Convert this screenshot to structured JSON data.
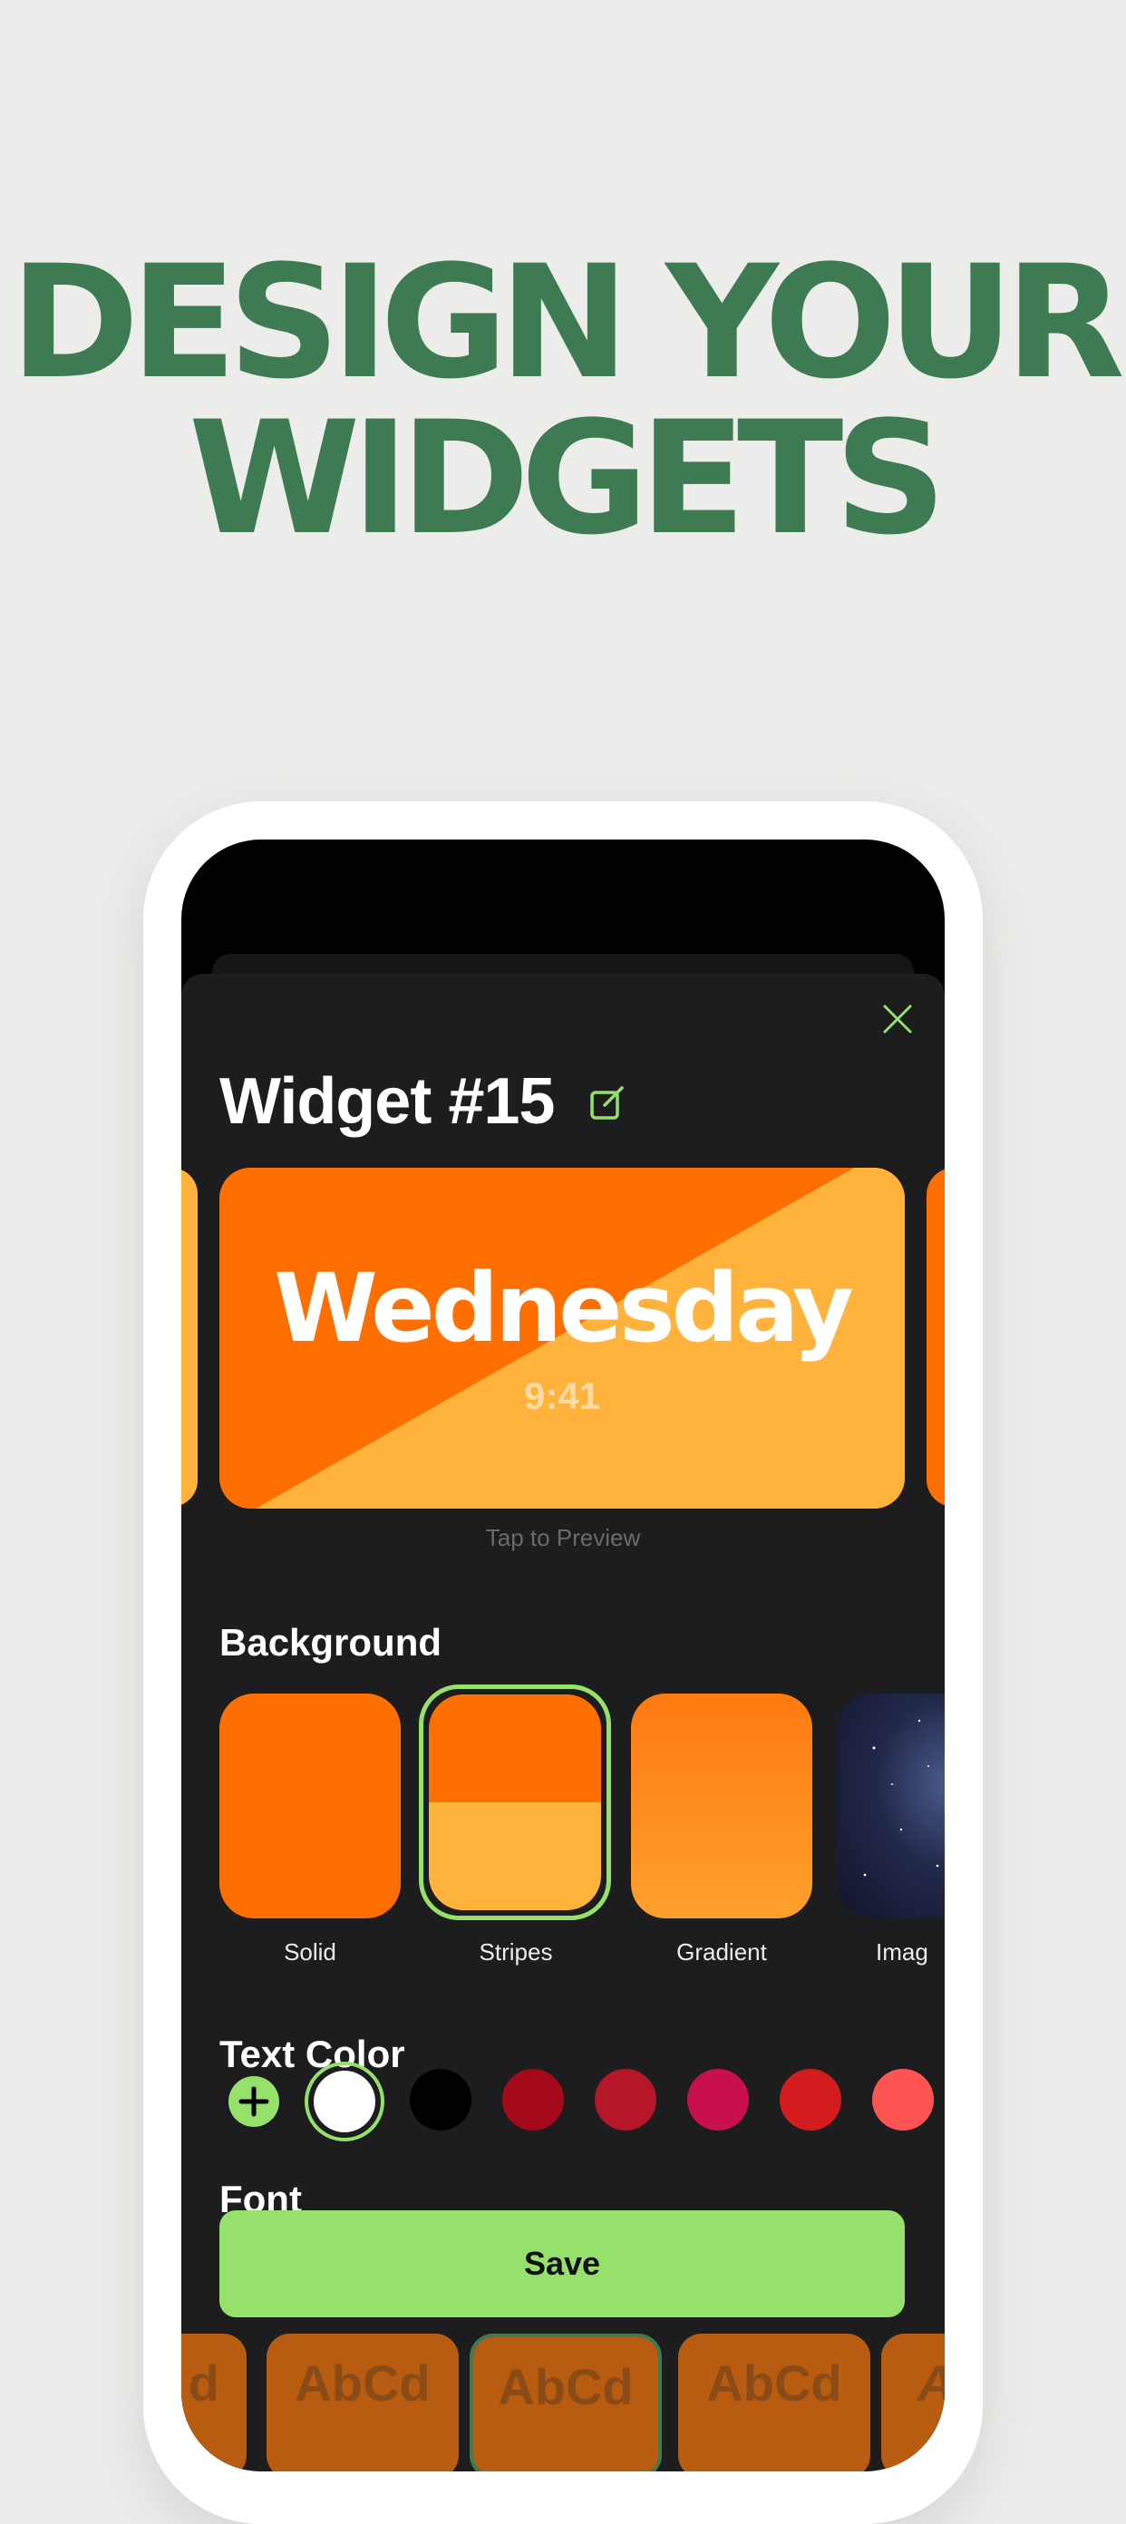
{
  "headline": {
    "line1": "DESIGN YOUR",
    "line2": "WIDGETS"
  },
  "sheet": {
    "title": "Widget #15",
    "close_icon": "close-icon",
    "edit_icon": "edit-icon"
  },
  "widget_preview": {
    "day": "Wednesday",
    "time": "9:41",
    "colors": {
      "primary": "#ff6e00",
      "secondary": "#ffb23c"
    },
    "hint": "Tap to Preview"
  },
  "background": {
    "title": "Background",
    "options": [
      {
        "label": "Solid"
      },
      {
        "label": "Stripes",
        "selected": true
      },
      {
        "label": "Gradient"
      },
      {
        "label": "Imag"
      }
    ]
  },
  "text_color": {
    "title": "Text Color",
    "add_icon": "plus-icon",
    "swatches": [
      "#ffffff",
      "#000000",
      "#a3091b",
      "#b5162a",
      "#c8104f",
      "#d41c1e",
      "#ff5454"
    ],
    "selected": "#ffffff"
  },
  "font": {
    "title": "Font",
    "samples": [
      "d",
      "AbCd",
      "AbCd",
      "AbCd",
      "A"
    ]
  },
  "save_label": "Save",
  "accent_color": "#96e06c"
}
